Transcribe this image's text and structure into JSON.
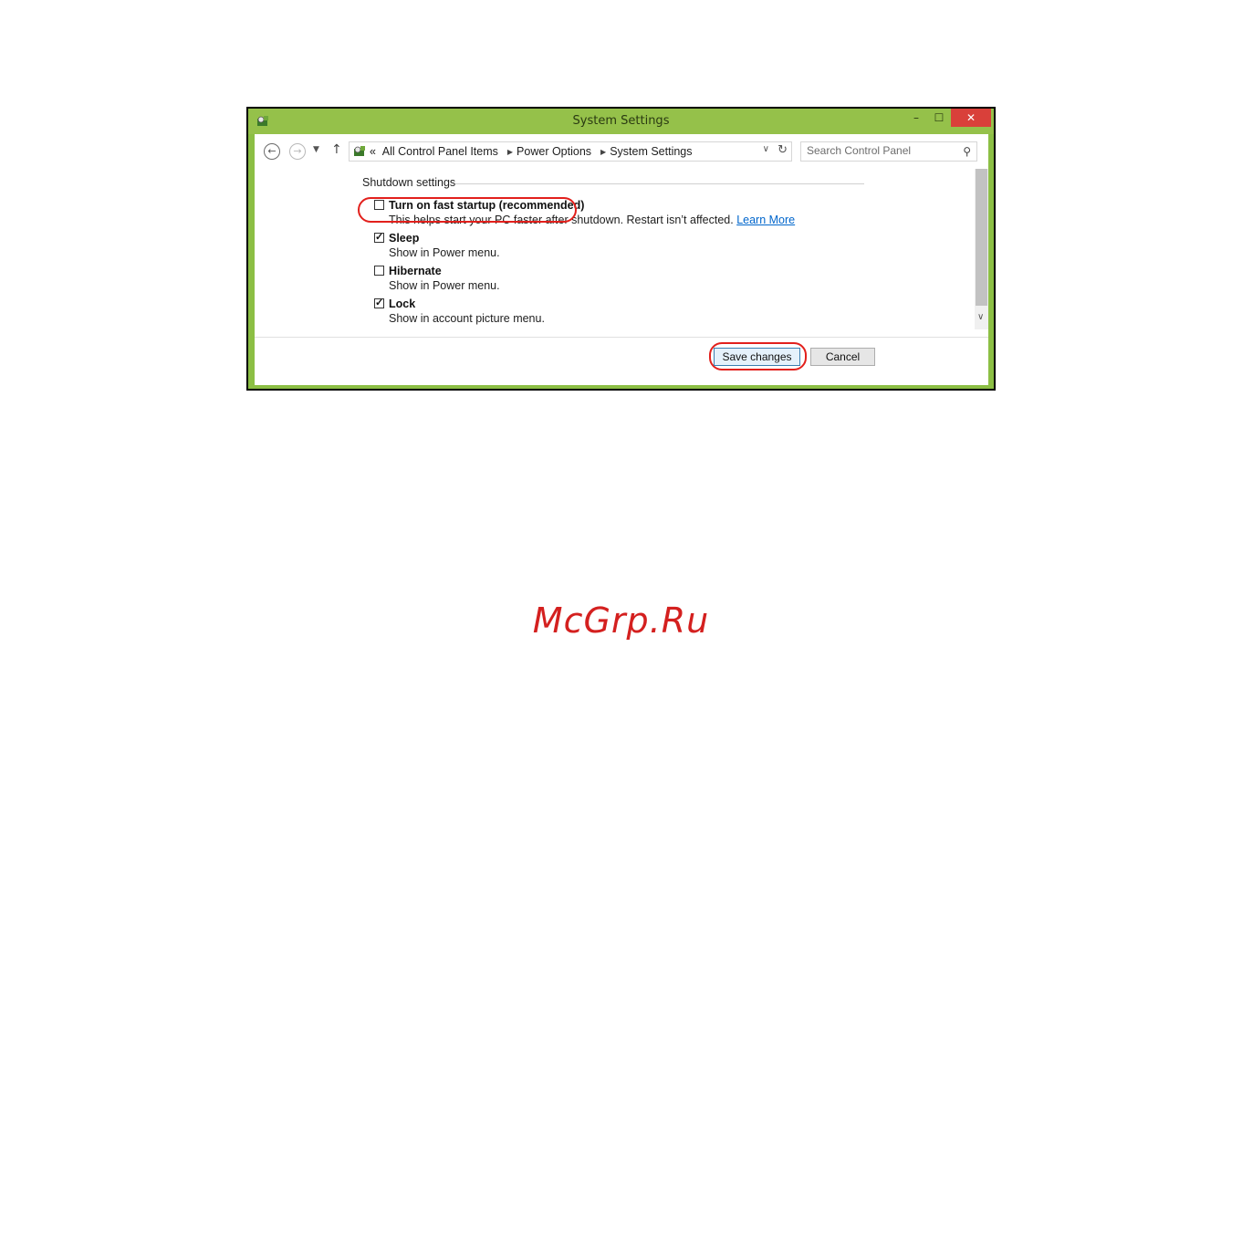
{
  "window": {
    "title": "System Settings",
    "minimize_glyph": "–",
    "maximize_glyph": "☐",
    "close_glyph": "✕"
  },
  "nav": {
    "back_glyph": "←",
    "forward_glyph": "→",
    "recent_glyph": "▼",
    "up_glyph": "↑",
    "breadcrumb_prefix": "«",
    "breadcrumbs": [
      "All Control Panel Items",
      "Power Options",
      "System Settings"
    ],
    "search_placeholder": "Search Control Panel"
  },
  "content": {
    "section_title": "Shutdown settings",
    "options": [
      {
        "label": "Turn on fast startup (recommended)",
        "checked": false,
        "description": "This helps start your PC faster after shutdown. Restart isn’t affected.",
        "link": "Learn More"
      },
      {
        "label": "Sleep",
        "checked": true,
        "description": "Show in Power menu."
      },
      {
        "label": "Hibernate",
        "checked": false,
        "description": "Show in Power menu."
      },
      {
        "label": "Lock",
        "checked": true,
        "description": "Show in account picture menu."
      }
    ]
  },
  "footer": {
    "save_label": "Save changes",
    "cancel_label": "Cancel"
  },
  "watermark": "McGrp.Ru",
  "colors": {
    "titlebar": "#95c14a",
    "close_button": "#d9403a",
    "highlight": "#e2201c",
    "link": "#0066cc"
  }
}
